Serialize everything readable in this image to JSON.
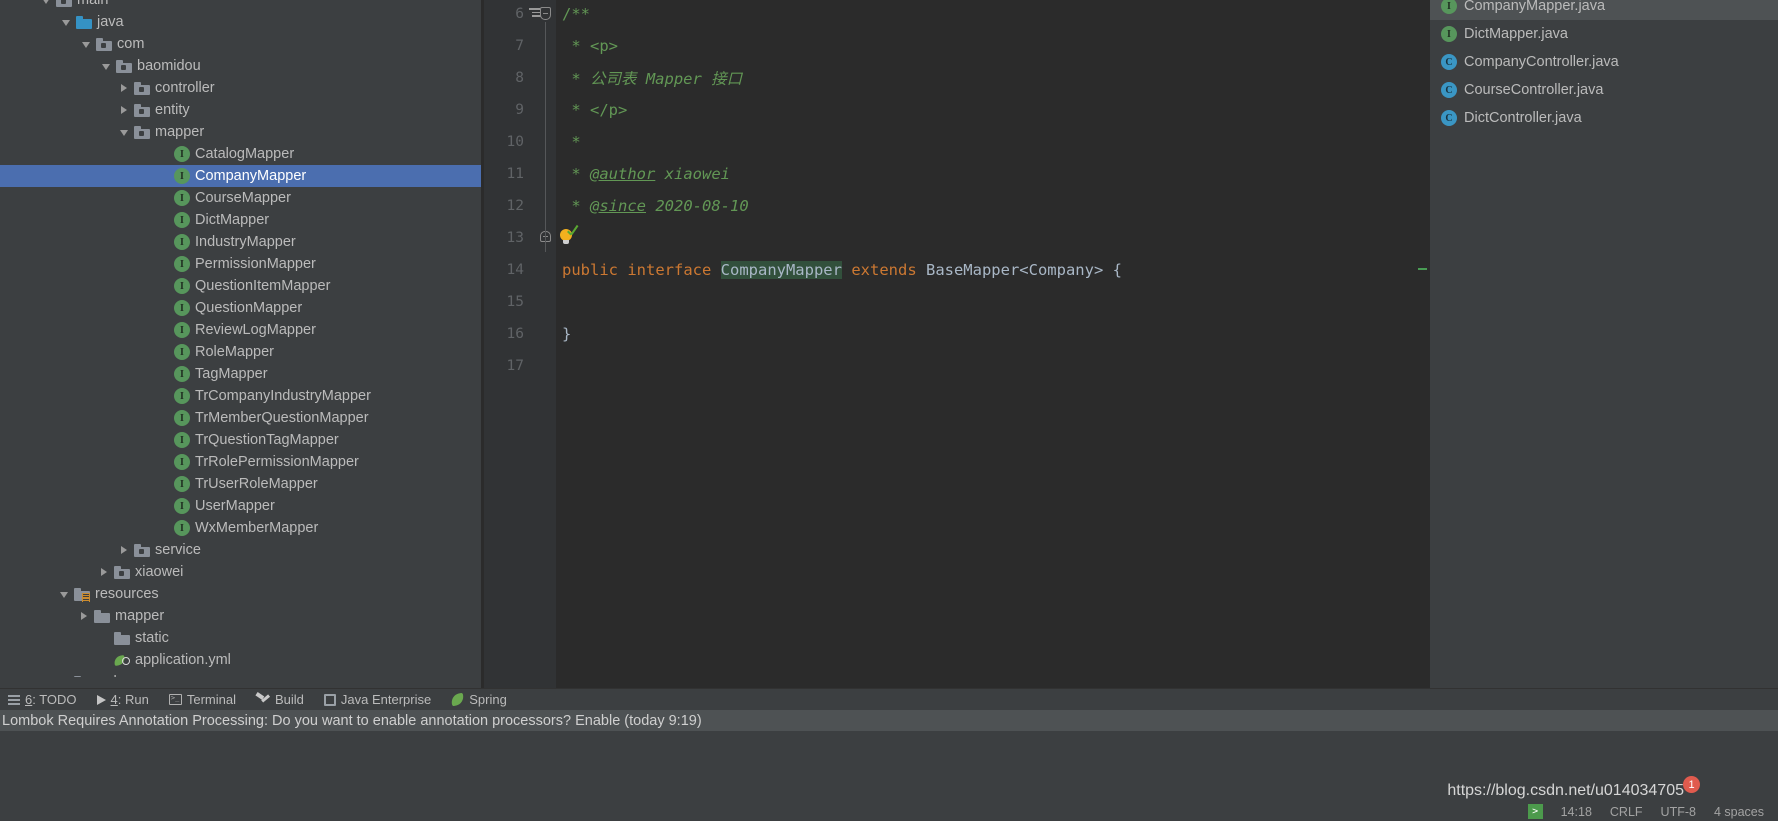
{
  "project_tree": {
    "rows": [
      {
        "label": "main",
        "indent": 40,
        "arrow": "expanded",
        "icon": "folder-module",
        "selected": false
      },
      {
        "label": "java",
        "indent": 60,
        "arrow": "expanded",
        "icon": "folder-source",
        "selected": false
      },
      {
        "label": "com",
        "indent": 80,
        "arrow": "expanded",
        "icon": "folder-module",
        "selected": false
      },
      {
        "label": "baomidou",
        "indent": 100,
        "arrow": "expanded",
        "icon": "folder-module",
        "selected": false
      },
      {
        "label": "controller",
        "indent": 118,
        "arrow": "collapsed",
        "icon": "folder-module",
        "selected": false
      },
      {
        "label": "entity",
        "indent": 118,
        "arrow": "collapsed",
        "icon": "folder-module",
        "selected": false
      },
      {
        "label": "mapper",
        "indent": 118,
        "arrow": "expanded",
        "icon": "folder-module",
        "selected": false
      },
      {
        "label": "CatalogMapper",
        "indent": 158,
        "arrow": "none",
        "icon": "interface",
        "selected": false
      },
      {
        "label": "CompanyMapper",
        "indent": 158,
        "arrow": "none",
        "icon": "interface",
        "selected": true
      },
      {
        "label": "CourseMapper",
        "indent": 158,
        "arrow": "none",
        "icon": "interface",
        "selected": false
      },
      {
        "label": "DictMapper",
        "indent": 158,
        "arrow": "none",
        "icon": "interface",
        "selected": false
      },
      {
        "label": "IndustryMapper",
        "indent": 158,
        "arrow": "none",
        "icon": "interface",
        "selected": false
      },
      {
        "label": "PermissionMapper",
        "indent": 158,
        "arrow": "none",
        "icon": "interface",
        "selected": false
      },
      {
        "label": "QuestionItemMapper",
        "indent": 158,
        "arrow": "none",
        "icon": "interface",
        "selected": false
      },
      {
        "label": "QuestionMapper",
        "indent": 158,
        "arrow": "none",
        "icon": "interface",
        "selected": false
      },
      {
        "label": "ReviewLogMapper",
        "indent": 158,
        "arrow": "none",
        "icon": "interface",
        "selected": false
      },
      {
        "label": "RoleMapper",
        "indent": 158,
        "arrow": "none",
        "icon": "interface",
        "selected": false
      },
      {
        "label": "TagMapper",
        "indent": 158,
        "arrow": "none",
        "icon": "interface",
        "selected": false
      },
      {
        "label": "TrCompanyIndustryMapper",
        "indent": 158,
        "arrow": "none",
        "icon": "interface",
        "selected": false
      },
      {
        "label": "TrMemberQuestionMapper",
        "indent": 158,
        "arrow": "none",
        "icon": "interface",
        "selected": false
      },
      {
        "label": "TrQuestionTagMapper",
        "indent": 158,
        "arrow": "none",
        "icon": "interface",
        "selected": false
      },
      {
        "label": "TrRolePermissionMapper",
        "indent": 158,
        "arrow": "none",
        "icon": "interface",
        "selected": false
      },
      {
        "label": "TrUserRoleMapper",
        "indent": 158,
        "arrow": "none",
        "icon": "interface",
        "selected": false
      },
      {
        "label": "UserMapper",
        "indent": 158,
        "arrow": "none",
        "icon": "interface",
        "selected": false
      },
      {
        "label": "WxMemberMapper",
        "indent": 158,
        "arrow": "none",
        "icon": "interface",
        "selected": false
      },
      {
        "label": "service",
        "indent": 118,
        "arrow": "collapsed",
        "icon": "folder-module",
        "selected": false
      },
      {
        "label": "xiaowei",
        "indent": 98,
        "arrow": "collapsed",
        "icon": "folder-module",
        "selected": false
      },
      {
        "label": "resources",
        "indent": 58,
        "arrow": "expanded",
        "icon": "folder-resource",
        "selected": false
      },
      {
        "label": "mapper",
        "indent": 78,
        "arrow": "collapsed",
        "icon": "folder-plain",
        "selected": false
      },
      {
        "label": "static",
        "indent": 98,
        "arrow": "none",
        "icon": "folder-plain",
        "selected": false
      },
      {
        "label": "application.yml",
        "indent": 98,
        "arrow": "none",
        "icon": "yml-spring",
        "selected": false
      },
      {
        "label": "webapp",
        "indent": 58,
        "arrow": "collapsed",
        "icon": "folder-plain",
        "selected": false
      }
    ]
  },
  "editor": {
    "lines": [
      {
        "num": "6",
        "segments": [
          {
            "text": "/**",
            "style": "cmt"
          }
        ]
      },
      {
        "num": "7",
        "segments": [
          {
            "text": " * ",
            "style": "cmt"
          },
          {
            "text": "<p>",
            "style": "cmt"
          }
        ]
      },
      {
        "num": "8",
        "segments": [
          {
            "text": " * ",
            "style": "cmt"
          },
          {
            "text": "公司表 Mapper 接口",
            "style": "cmt-doc"
          }
        ]
      },
      {
        "num": "9",
        "segments": [
          {
            "text": " * ",
            "style": "cmt"
          },
          {
            "text": "</p>",
            "style": "cmt"
          }
        ]
      },
      {
        "num": "10",
        "segments": [
          {
            "text": " *",
            "style": "cmt"
          }
        ]
      },
      {
        "num": "11",
        "segments": [
          {
            "text": " * ",
            "style": "cmt"
          },
          {
            "text": "@author",
            "style": "cmt-tag"
          },
          {
            "text": " xiaowei",
            "style": "cmt-doc"
          }
        ]
      },
      {
        "num": "12",
        "segments": [
          {
            "text": " * ",
            "style": "cmt"
          },
          {
            "text": "@since",
            "style": "cmt-tag"
          },
          {
            "text": " 2020-08-10",
            "style": "cmt-doc"
          }
        ]
      },
      {
        "num": "13",
        "segments": []
      },
      {
        "num": "14",
        "segments": [
          {
            "text": "public ",
            "style": "kw"
          },
          {
            "text": "interface ",
            "style": "kw"
          },
          {
            "text": "CompanyMapper",
            "style": "cls-name"
          },
          {
            "text": " ",
            "style": "plain"
          },
          {
            "text": "extends ",
            "style": "kw"
          },
          {
            "text": "BaseMapper<Company> {",
            "style": "plain"
          }
        ]
      },
      {
        "num": "15",
        "segments": []
      },
      {
        "num": "16",
        "segments": [
          {
            "text": "}",
            "style": "plain"
          }
        ]
      },
      {
        "num": "17",
        "segments": []
      }
    ]
  },
  "recent_files": {
    "rows": [
      {
        "label": "CompanyMapper.java",
        "icon": "interface",
        "selected": true
      },
      {
        "label": "DictMapper.java",
        "icon": "interface",
        "selected": false
      },
      {
        "label": "CompanyController.java",
        "icon": "class",
        "selected": false
      },
      {
        "label": "CourseController.java",
        "icon": "class",
        "selected": false
      },
      {
        "label": "DictController.java",
        "icon": "class",
        "selected": false
      }
    ]
  },
  "tool_bar": {
    "buttons": [
      {
        "label": "6: TODO",
        "mnemonic": "6",
        "rest": ": TODO",
        "icon": "todo-icon"
      },
      {
        "label": "4: Run",
        "mnemonic": "4",
        "rest": ": Run",
        "icon": "run-icon"
      },
      {
        "label": "Terminal",
        "mnemonic": "",
        "rest": "Terminal",
        "icon": "terminal-icon"
      },
      {
        "label": "Build",
        "mnemonic": "",
        "rest": "Build",
        "icon": "build-icon"
      },
      {
        "label": "Java Enterprise",
        "mnemonic": "",
        "rest": "Java Enterprise",
        "icon": "java-enterprise-icon"
      },
      {
        "label": "Spring",
        "mnemonic": "",
        "rest": "Spring",
        "icon": "spring-icon"
      }
    ]
  },
  "notification": {
    "message": "Lombok Requires Annotation Processing: Do you want to enable annotation processors? Enable (today 9:19)"
  },
  "watermark": {
    "url": "https://blog.csdn.net/u014034705",
    "badge": "1"
  },
  "status_bar": {
    "git_glyph": ">",
    "caret_position": "14:18",
    "line_separator": "CRLF",
    "encoding": "UTF-8",
    "indent": "4 spaces"
  },
  "colors": {
    "panel_bg": "#3c3f41",
    "editor_bg": "#2b2b2b",
    "selection_blue": "#4b6eaf",
    "interface_green": "#57965c",
    "class_blue": "#3a96c4",
    "keyword_orange": "#cc7832",
    "comment_green": "#629755",
    "badge_red": "#e05b4e"
  }
}
